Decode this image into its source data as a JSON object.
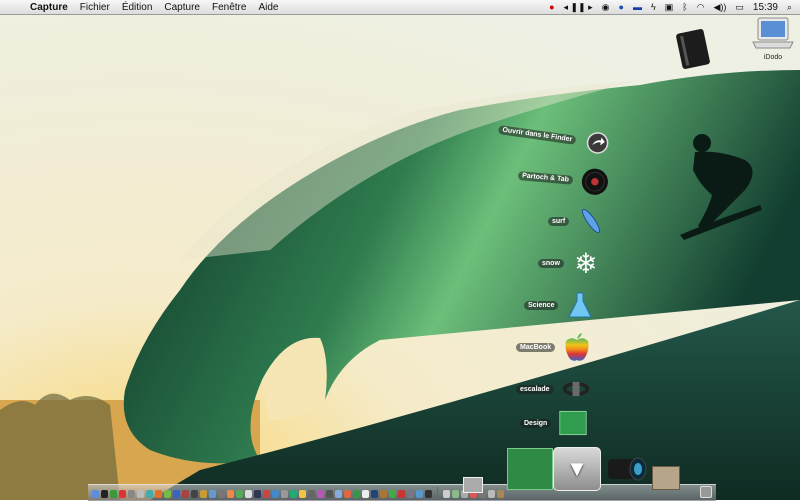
{
  "menubar": {
    "app_name": "Capture",
    "menus": [
      "Fichier",
      "Édition",
      "Capture",
      "Fenêtre",
      "Aide"
    ],
    "clock": "15:39"
  },
  "desktop": {
    "drive_label": "iDodo"
  },
  "stack": {
    "items": [
      {
        "label": "Ouvrir dans le Finder",
        "icon": "arrow-circle-icon"
      },
      {
        "label": "Partoch & Tab",
        "icon": "vinyl-record-icon"
      },
      {
        "label": "surf",
        "icon": "surfboard-icon"
      },
      {
        "label": "snow",
        "icon": "snowflake-icon"
      },
      {
        "label": "Science",
        "icon": "flask-icon"
      },
      {
        "label": "MacBook",
        "icon": "apple-logo-icon"
      },
      {
        "label": "escalade",
        "icon": "harness-icon"
      },
      {
        "label": "Design",
        "icon": "green-folder-icon"
      }
    ]
  },
  "colors": {
    "wave_dark": "#0d3a2a",
    "wave_light": "#4fa86a",
    "sky": "#f4efd9",
    "sun": "#f3c24a"
  }
}
